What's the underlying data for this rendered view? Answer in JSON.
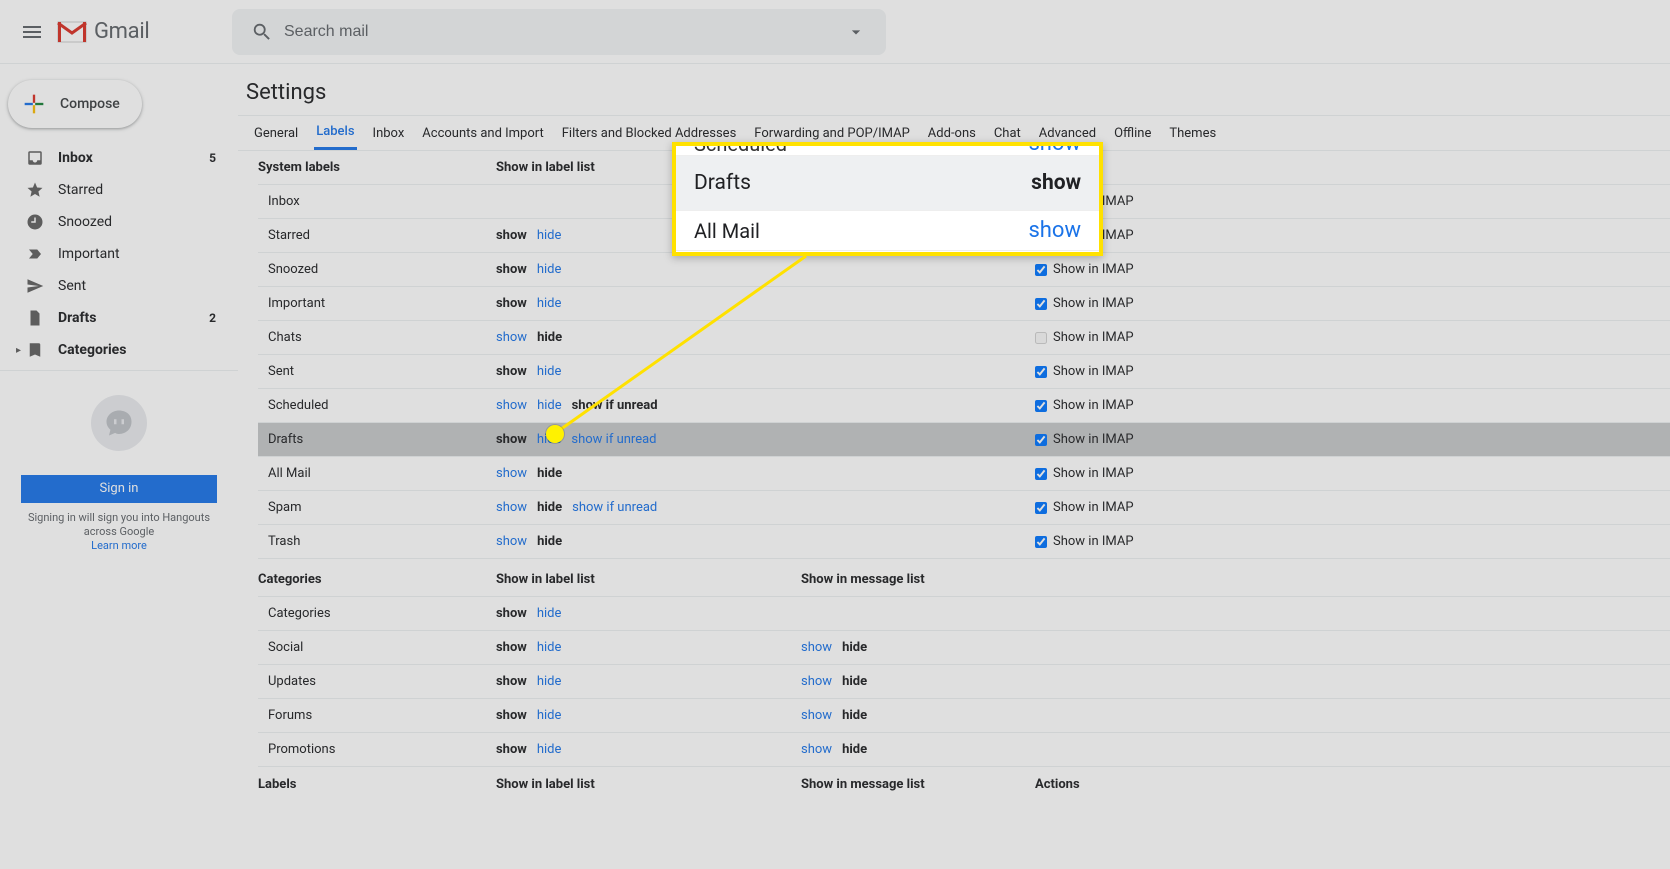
{
  "header": {
    "product": "Gmail",
    "search_placeholder": "Search mail"
  },
  "compose_label": "Compose",
  "sidebar": {
    "items": [
      {
        "icon": "inbox",
        "label": "Inbox",
        "count": "5",
        "bold": true
      },
      {
        "icon": "star",
        "label": "Starred",
        "count": "",
        "bold": false
      },
      {
        "icon": "clock",
        "label": "Snoozed",
        "count": "",
        "bold": false
      },
      {
        "icon": "important",
        "label": "Important",
        "count": "",
        "bold": false
      },
      {
        "icon": "send",
        "label": "Sent",
        "count": "",
        "bold": false
      },
      {
        "icon": "file",
        "label": "Drafts",
        "count": "2",
        "bold": true
      },
      {
        "icon": "tag",
        "label": "Categories",
        "count": "",
        "bold": true,
        "cat": true
      }
    ]
  },
  "hangouts": {
    "signin": "Sign in",
    "note_1": "Signing in will sign you into Hangouts across Google",
    "learn_more": "Learn more"
  },
  "settings": {
    "title": "Settings",
    "tabs": [
      "General",
      "Labels",
      "Inbox",
      "Accounts and Import",
      "Filters and Blocked Addresses",
      "Forwarding and POP/IMAP",
      "Add-ons",
      "Chat",
      "Advanced",
      "Offline",
      "Themes"
    ],
    "active_tab_index": 1,
    "col_system": "System labels",
    "col_showlist": "Show in label list",
    "col_msglist": "Show in message list",
    "col_actions": "Actions",
    "imap_label": "Show in IMAP",
    "system_rows": [
      {
        "name": "Inbox",
        "opts": [],
        "imap": true,
        "imap_disabled": false
      },
      {
        "name": "Starred",
        "opts": [
          {
            "t": "show",
            "sel": true
          },
          {
            "t": "hide"
          }
        ],
        "imap": true
      },
      {
        "name": "Snoozed",
        "opts": [
          {
            "t": "show",
            "sel": true
          },
          {
            "t": "hide"
          }
        ],
        "imap": true
      },
      {
        "name": "Important",
        "opts": [
          {
            "t": "show",
            "sel": true
          },
          {
            "t": "hide"
          }
        ],
        "imap": true
      },
      {
        "name": "Chats",
        "opts": [
          {
            "t": "show"
          },
          {
            "t": "hide",
            "sel": true
          }
        ],
        "imap": false,
        "imap_disabled": true
      },
      {
        "name": "Sent",
        "opts": [
          {
            "t": "show",
            "sel": true
          },
          {
            "t": "hide"
          }
        ],
        "imap": true
      },
      {
        "name": "Scheduled",
        "opts": [
          {
            "t": "show"
          },
          {
            "t": "hide"
          },
          {
            "t": "show if unread",
            "sel": true
          }
        ],
        "imap": true
      },
      {
        "name": "Drafts",
        "opts": [
          {
            "t": "show",
            "sel": true
          },
          {
            "t": "hide"
          },
          {
            "t": "show if unread"
          }
        ],
        "imap": true,
        "highlight": true
      },
      {
        "name": "All Mail",
        "opts": [
          {
            "t": "show"
          },
          {
            "t": "hide",
            "sel": true
          }
        ],
        "imap": true
      },
      {
        "name": "Spam",
        "opts": [
          {
            "t": "show"
          },
          {
            "t": "hide",
            "sel": true
          },
          {
            "t": "show if unread"
          }
        ],
        "imap": true
      },
      {
        "name": "Trash",
        "opts": [
          {
            "t": "show"
          },
          {
            "t": "hide",
            "sel": true
          }
        ],
        "imap": true
      }
    ],
    "categories_label": "Categories",
    "category_rows": [
      {
        "name": "Categories",
        "opts": [
          {
            "t": "show",
            "sel": true
          },
          {
            "t": "hide"
          }
        ],
        "msg": []
      },
      {
        "name": "Social",
        "opts": [
          {
            "t": "show",
            "sel": true
          },
          {
            "t": "hide"
          }
        ],
        "msg": [
          {
            "t": "show"
          },
          {
            "t": "hide",
            "sel": true
          }
        ]
      },
      {
        "name": "Updates",
        "opts": [
          {
            "t": "show",
            "sel": true
          },
          {
            "t": "hide"
          }
        ],
        "msg": [
          {
            "t": "show"
          },
          {
            "t": "hide",
            "sel": true
          }
        ]
      },
      {
        "name": "Forums",
        "opts": [
          {
            "t": "show",
            "sel": true
          },
          {
            "t": "hide"
          }
        ],
        "msg": [
          {
            "t": "show"
          },
          {
            "t": "hide",
            "sel": true
          }
        ]
      },
      {
        "name": "Promotions",
        "opts": [
          {
            "t": "show",
            "sel": true
          },
          {
            "t": "hide"
          }
        ],
        "msg": [
          {
            "t": "show"
          },
          {
            "t": "hide",
            "sel": true
          }
        ]
      }
    ],
    "labels_label": "Labels"
  },
  "callout": {
    "top_label": "Scheduled",
    "top_opt": "show",
    "mid_label": "Drafts",
    "mid_opt": "show",
    "bot_label": "All Mail",
    "bot_opt": "show"
  }
}
